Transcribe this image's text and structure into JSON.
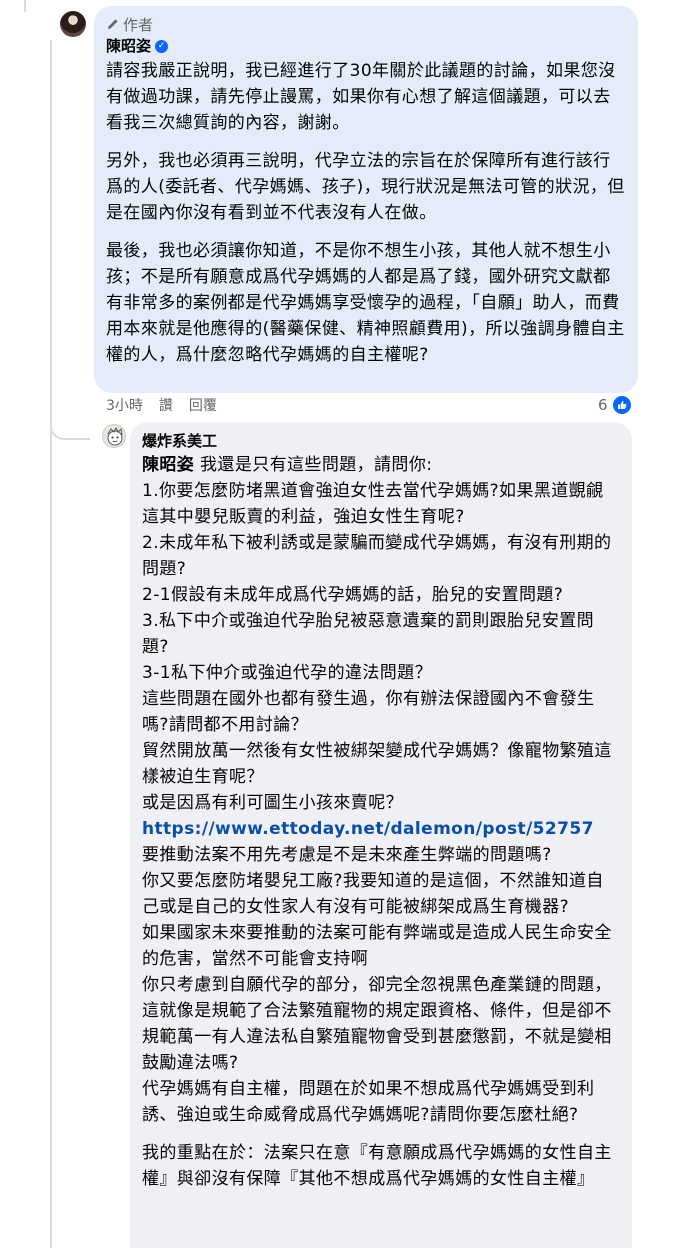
{
  "author_comment": {
    "badge": "作者",
    "name": "陳昭姿",
    "paragraphs": [
      "請容我嚴正說明，我已經進行了30年關於此議題的討論，如果您沒有做過功課，請先停止謾罵，如果你有心想了解這個議題，可以去看我三次總質詢的內容，謝謝。",
      "另外，我也必須再三說明，代孕立法的宗旨在於保障所有進行該行爲的人(委託者、代孕媽媽、孩子)，現行狀況是無法可管的狀況，但是在國內你沒有看到並不代表沒有人在做。",
      "最後，我也必須讓你知道，不是你不想生小孩，其他人就不想生小孩；不是所有願意成爲代孕媽媽的人都是爲了錢，國外研究文獻都有非常多的案例都是代孕媽媽享受懷孕的過程，「自願」助人，而費用本來就是他應得的(醫藥保健、精神照顧費用)，所以強調身體自主權的人，爲什麼忽略代孕媽媽的自主權呢?"
    ],
    "time": "3小時",
    "like_label": "讚",
    "reply_label": "回覆",
    "reaction_count": "6"
  },
  "reply_comment": {
    "name": "爆炸系美工",
    "mention": "陳昭姿",
    "lines": [
      "我還是只有這些問題，請問你:",
      "1.你要怎麼防堵黑道會強迫女性去當代孕媽媽?如果黑道覬覦這其中嬰兒販賣的利益，強迫女性生育呢?",
      "2.未成年私下被利誘或是蒙騙而變成代孕媽媽，有沒有刑期的問題?",
      "2-1假設有未成年成爲代孕媽媽的話，胎兒的安置問題?",
      "3.私下中介或強迫代孕胎兒被惡意遺棄的罰則跟胎兒安置問題?",
      "3-1私下仲介或強迫代孕的違法問題？",
      "這些問題在國外也都有發生過，你有辦法保證國內不會發生嗎?請問都不用討論？",
      "貿然開放萬一然後有女性被綁架變成代孕媽媽？像寵物繁殖這樣被迫生育呢？",
      "或是因爲有利可圖生小孩來賣呢？"
    ],
    "link": "https://www.ettoday.net/dalemon/post/52757",
    "lines_after": [
      "要推動法案不用先考慮是不是未來產生弊端的問題嗎?",
      "你又要怎麼防堵嬰兒工廠?我要知道的是這個，不然誰知道自己或是自己的女性家人有沒有可能被綁架成爲生育機器?",
      "如果國家未來要推動的法案可能有弊端或是造成人民生命安全的危害，當然不可能會支持啊",
      "你只考慮到自願代孕的部分，卻完全忽視黑色產業鏈的問題，這就像是規範了合法繁殖寵物的規定跟資格、條件，但是卻不規範萬一有人違法私自繁殖寵物會受到甚麼懲罰，不就是變相鼓勵違法嗎?",
      "代孕媽媽有自主權，問題在於如果不想成爲代孕媽媽受到利誘、強迫或生命威脅成爲代孕媽媽呢?請問你要怎麼杜絕?"
    ],
    "final_paragraph": "我的重點在於：法案只在意『有意願成爲代孕媽媽的女性自主權』與卻沒有保障『其他不想成爲代孕媽媽的女性自主權』"
  },
  "colors": {
    "author_bubble": "#e4ecf9",
    "reply_bubble": "#eef0f3",
    "link": "#0a4ea8",
    "meta_text": "#65676b",
    "like_blue": "#0866ff"
  }
}
